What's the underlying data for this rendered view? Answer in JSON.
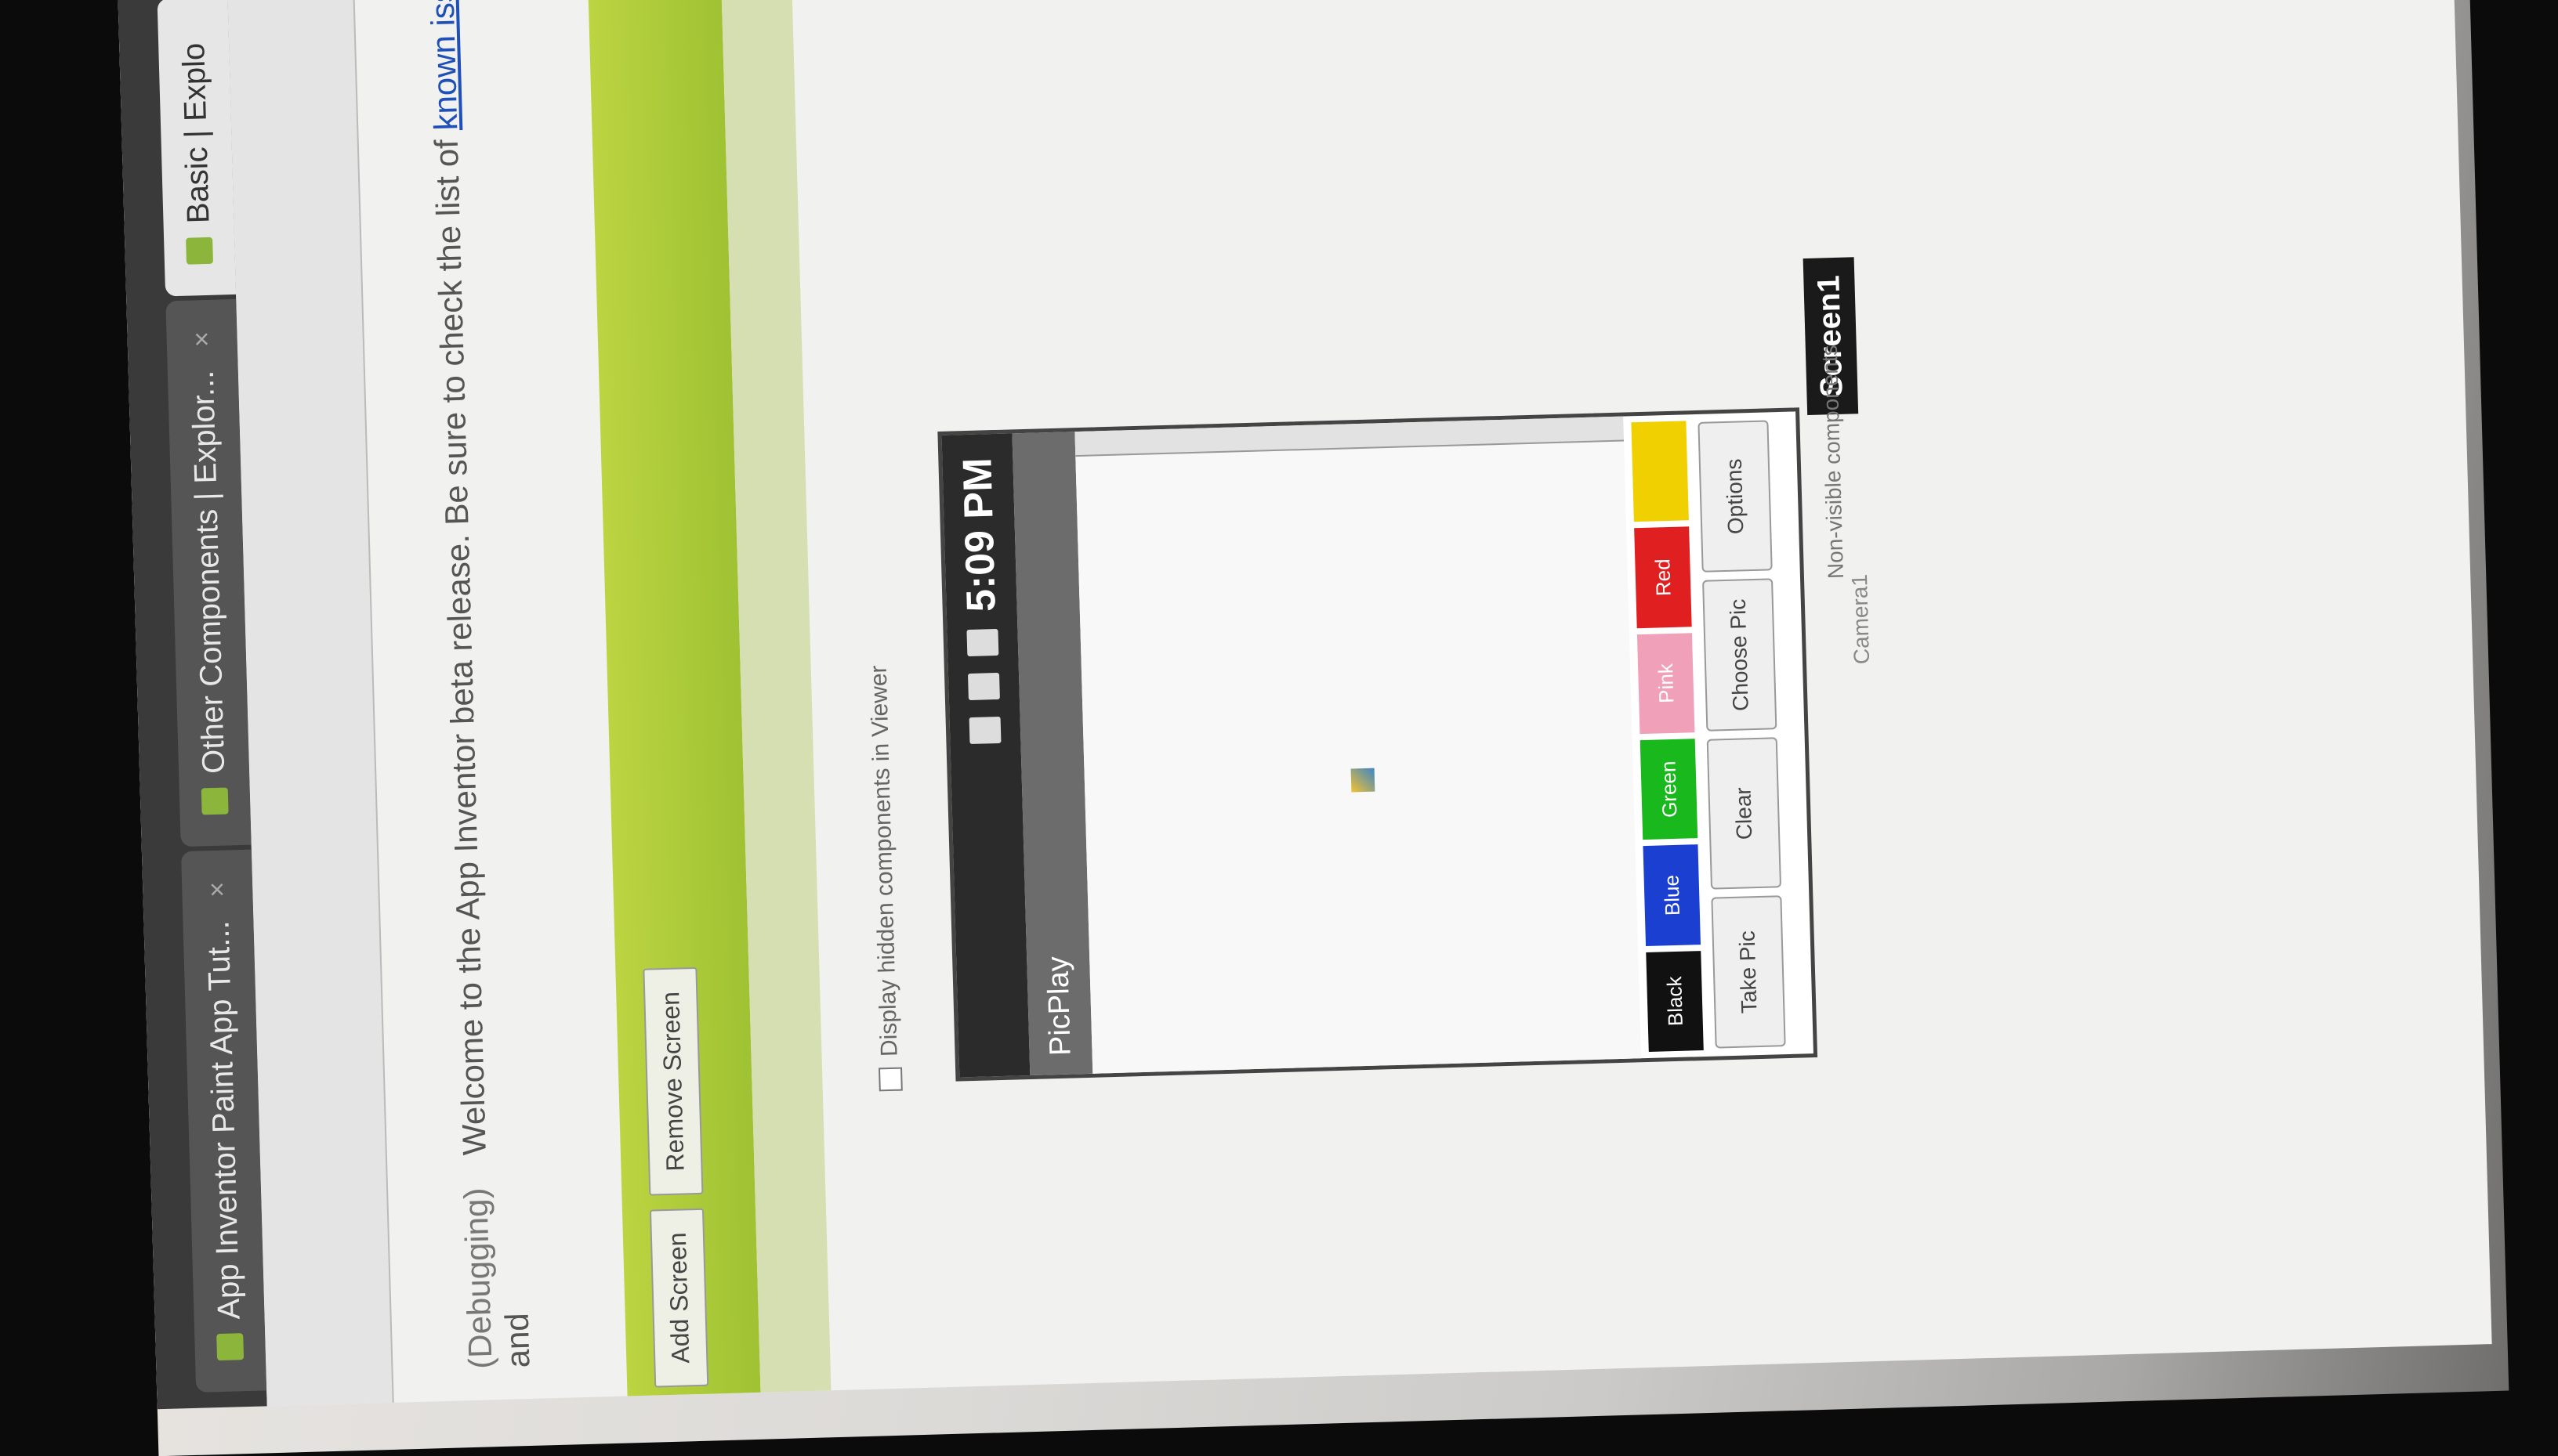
{
  "tabs": [
    {
      "label": "App Inventor Paint App Tut...",
      "active": false
    },
    {
      "label": "Other Components | Explor...",
      "active": false
    },
    {
      "label": "Basic | Explo",
      "active": true
    }
  ],
  "notice": {
    "prefix": "(Debugging)",
    "text": "Welcome to the App Inventor beta release.  Be sure to check the list of",
    "link": "known issues",
    "suffix": "and"
  },
  "screen_buttons": {
    "add": "Add Screen",
    "remove": "Remove Screen"
  },
  "viewer": {
    "hidden_components_label": "Display hidden components in Viewer"
  },
  "phone": {
    "time": "5:09 PM",
    "app_title": "PicPlay",
    "colors": [
      {
        "label": "Black",
        "color": "#111111"
      },
      {
        "label": "Blue",
        "color": "#1a3fd1"
      },
      {
        "label": "Green",
        "color": "#19b81c"
      },
      {
        "label": "Pink",
        "color": "#f0a0b8"
      },
      {
        "label": "Red",
        "color": "#e02020"
      },
      {
        "label": "",
        "color": "#f0d000"
      }
    ],
    "actions": [
      "Take Pic",
      "Clear",
      "Choose Pic",
      "Options"
    ]
  },
  "screen_name": "Screen1",
  "non_visible": {
    "label": "Non-visible components",
    "item": "Camera1"
  }
}
